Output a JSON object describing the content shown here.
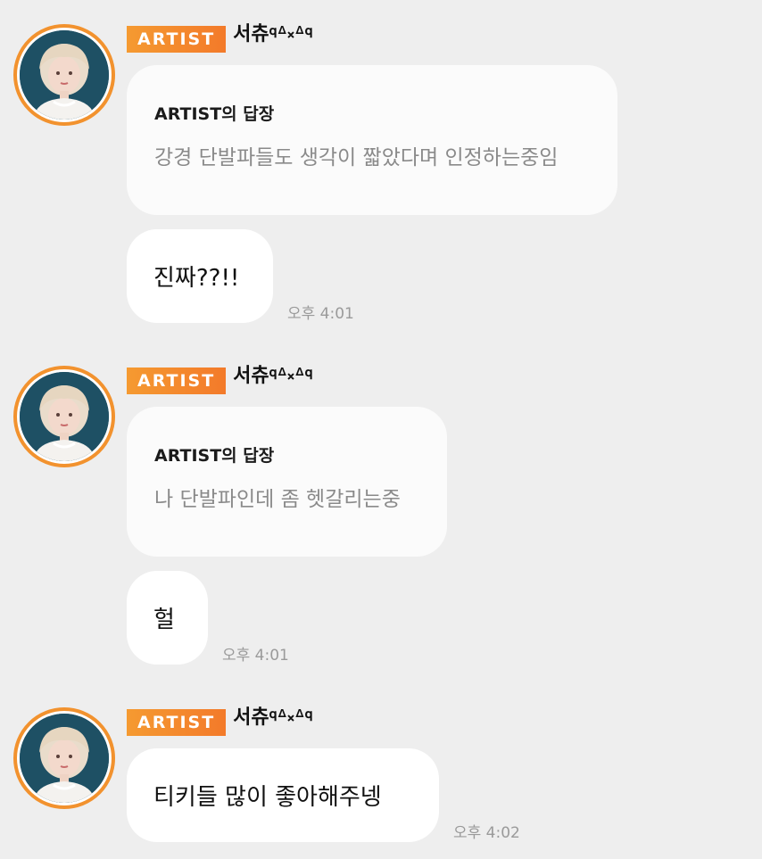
{
  "messages": [
    {
      "badge": "ARTIST",
      "sender": "서츄𐞥ᐞ༝ᐞ𐞥",
      "reply_title": "ARTIST의 답장",
      "reply_text": "강경 단발파들도 생각이 짧았다며 인정하는중임",
      "text": "진짜??!!",
      "time": "오후 4:01"
    },
    {
      "badge": "ARTIST",
      "sender": "서츄𐞥ᐞ༝ᐞ𐞥",
      "reply_title": "ARTIST의 답장",
      "reply_text": "나 단발파인데 좀 헷갈리는중",
      "text": "헐",
      "time": "오후 4:01"
    },
    {
      "badge": "ARTIST",
      "sender": "서츄𐞥ᐞ༝ᐞ𐞥",
      "text": "티키들 많이 좋아해주넹",
      "time": "오후 4:02"
    }
  ],
  "colors": {
    "background": "#eeeeee",
    "badge": "#f37a2a",
    "avatar_ring": "#f2922e",
    "bubble": "#ffffff"
  }
}
